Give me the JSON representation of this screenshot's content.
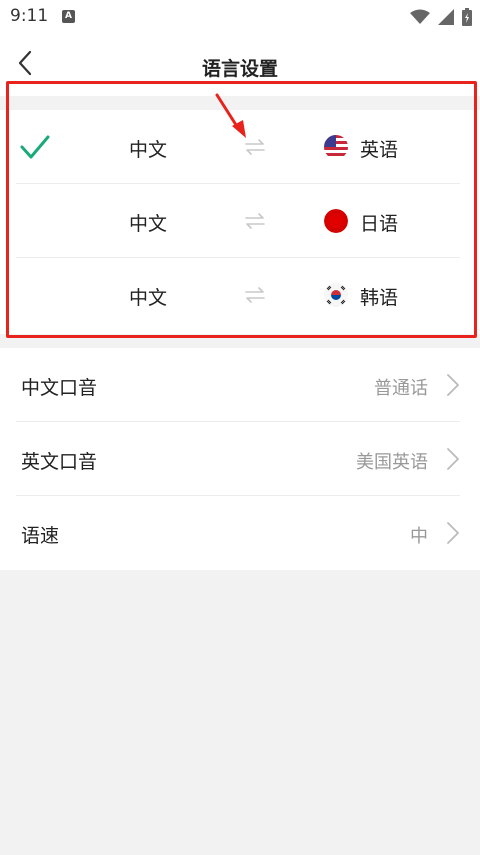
{
  "status_bar": {
    "time": "9:11",
    "notification_glyph": "A"
  },
  "header": {
    "title": "语言设置"
  },
  "language_pairs": [
    {
      "source": "中文",
      "target": "英语",
      "flag": "us-flag-icon",
      "selected": true
    },
    {
      "source": "中文",
      "target": "日语",
      "flag": "japan-flag-icon",
      "selected": false
    },
    {
      "source": "中文",
      "target": "韩语",
      "flag": "korea-flag-icon",
      "selected": false
    }
  ],
  "settings": [
    {
      "label": "中文口音",
      "value": "普通话"
    },
    {
      "label": "英文口音",
      "value": "美国英语"
    },
    {
      "label": "语速",
      "value": "中"
    }
  ],
  "colors": {
    "check": "#1aaa7a",
    "highlight": "#e8221c",
    "background": "#f2f2f2"
  }
}
